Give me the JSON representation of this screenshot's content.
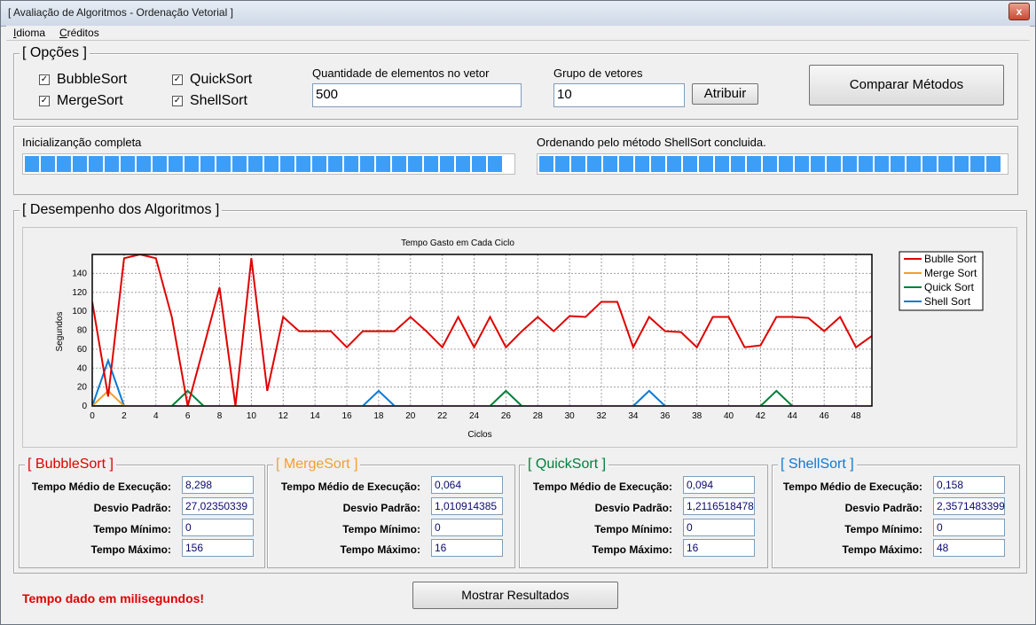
{
  "window": {
    "title": "[ Avaliação de Algoritmos - Ordenação Vetorial ]",
    "close": "x"
  },
  "menu": [
    {
      "first": "I",
      "rest": "dioma"
    },
    {
      "first": "C",
      "rest": "réditos"
    }
  ],
  "options": {
    "title": "[ Opções ]",
    "checkboxes": [
      {
        "label": "BubbleSort",
        "checked": true
      },
      {
        "label": "MergeSort",
        "checked": true
      },
      {
        "label": "QuickSort",
        "checked": true
      },
      {
        "label": "ShellSort",
        "checked": true
      }
    ],
    "check_mark": "✓",
    "qty_label": "Quantidade de elementos no vetor",
    "qty_value": "500",
    "group_label": "Grupo de vetores",
    "group_value": "10",
    "assign_button": "Atribuir",
    "compare_button": "Comparar Métodos"
  },
  "progress": {
    "left_label": "Inicializanção completa",
    "left_fraction": 1.0,
    "right_label": "Ordenando pelo método ShellSort concluida.",
    "right_fraction": 1.0
  },
  "performance": {
    "title": "[ Desempenho dos Algoritmos ]"
  },
  "chart_data": {
    "type": "line",
    "title": "Tempo Gasto em Cada Ciclo",
    "xlabel": "Ciclos",
    "ylabel": "Segundos",
    "xlim": [
      0,
      49
    ],
    "ylim": [
      0,
      160
    ],
    "xticks": [
      0,
      2,
      4,
      6,
      8,
      10,
      12,
      14,
      16,
      18,
      20,
      22,
      24,
      26,
      28,
      30,
      32,
      34,
      36,
      38,
      40,
      42,
      44,
      46,
      48
    ],
    "yticks": [
      0,
      20,
      40,
      60,
      80,
      100,
      120,
      140
    ],
    "grid": true,
    "legend": "top-right",
    "x": [
      0,
      1,
      2,
      3,
      4,
      5,
      6,
      7,
      8,
      9,
      10,
      11,
      12,
      13,
      14,
      15,
      16,
      17,
      18,
      19,
      20,
      21,
      22,
      23,
      24,
      25,
      26,
      27,
      28,
      29,
      30,
      31,
      32,
      33,
      34,
      35,
      36,
      37,
      38,
      39,
      40,
      41,
      42,
      43,
      44,
      45,
      46,
      47,
      48,
      49
    ],
    "series": [
      {
        "name": "Bublle Sort",
        "color": "#e00000",
        "values": [
          110,
          10,
          156,
          160,
          156,
          94,
          0,
          62,
          125,
          0,
          156,
          16,
          94,
          79,
          79,
          79,
          62,
          79,
          79,
          79,
          94,
          79,
          62,
          94,
          62,
          94,
          62,
          79,
          94,
          79,
          95,
          94,
          110,
          110,
          62,
          94,
          79,
          78,
          62,
          94,
          94,
          62,
          64,
          94,
          94,
          93,
          79,
          94,
          62,
          74
        ]
      },
      {
        "name": "Merge Sort",
        "color": "#f0a030",
        "values": [
          0,
          16,
          0,
          0,
          0,
          0,
          0,
          0,
          0,
          0,
          0,
          0,
          0,
          0,
          0,
          0,
          0,
          0,
          0,
          0,
          0,
          0,
          0,
          0,
          0,
          0,
          0,
          0,
          0,
          0,
          0,
          0,
          0,
          0,
          0,
          0,
          0,
          0,
          0,
          0,
          0,
          0,
          0,
          0,
          0,
          0,
          0,
          0,
          0,
          0
        ]
      },
      {
        "name": "Quick Sort",
        "color": "#00803a",
        "values": [
          0,
          0,
          0,
          0,
          0,
          0,
          16,
          0,
          0,
          0,
          0,
          0,
          0,
          0,
          0,
          0,
          0,
          0,
          0,
          0,
          0,
          0,
          0,
          0,
          0,
          0,
          16,
          0,
          0,
          0,
          0,
          0,
          0,
          0,
          0,
          0,
          0,
          0,
          0,
          0,
          0,
          0,
          0,
          16,
          0,
          0,
          0,
          0,
          0,
          0
        ]
      },
      {
        "name": "Shell Sort",
        "color": "#0a7ad6",
        "values": [
          0,
          48,
          0,
          0,
          0,
          0,
          0,
          0,
          0,
          0,
          0,
          0,
          0,
          0,
          0,
          0,
          0,
          0,
          16,
          0,
          0,
          0,
          0,
          0,
          0,
          0,
          0,
          0,
          0,
          0,
          0,
          0,
          0,
          0,
          0,
          16,
          0,
          0,
          0,
          0,
          0,
          0,
          0,
          0,
          0,
          0,
          0,
          0,
          0,
          0
        ]
      }
    ]
  },
  "stats": [
    {
      "title": "[ BubbleSort ]",
      "color": "#e00000",
      "avg_label": "Tempo Médio de Execução:",
      "avg": "8,298",
      "std_label": "Desvio Padrão:",
      "std": "27,02350339",
      "min_label": "Tempo Mínimo:",
      "min": "0",
      "max_label": "Tempo Máximo:",
      "max": "156"
    },
    {
      "title": "[ MergeSort ]",
      "color": "#f0a030",
      "avg_label": "Tempo Médio de Execução:",
      "avg": "0,064",
      "std_label": "Desvio Padrão:",
      "std": "1,010914385",
      "min_label": "Tempo Mínimo:",
      "min": "0",
      "max_label": "Tempo Máximo:",
      "max": "16"
    },
    {
      "title": "[ QuickSort ]",
      "color": "#00803a",
      "avg_label": "Tempo Médio de Execução:",
      "avg": "0,094",
      "std_label": "Desvio Padrão:",
      "std": "1,2116518478",
      "min_label": "Tempo Mínimo:",
      "min": "0",
      "max_label": "Tempo Máximo:",
      "max": "16"
    },
    {
      "title": "[ ShellSort ]",
      "color": "#0a7ad6",
      "avg_label": "Tempo Médio de Execução:",
      "avg": "0,158",
      "std_label": "Desvio Padrão:",
      "std": "2,3571483399",
      "min_label": "Tempo Mínimo:",
      "min": "0",
      "max_label": "Tempo Máximo:",
      "max": "48"
    }
  ],
  "footer": {
    "note": "Tempo dado em milisegundos!",
    "show_button": "Mostrar Resultados"
  }
}
